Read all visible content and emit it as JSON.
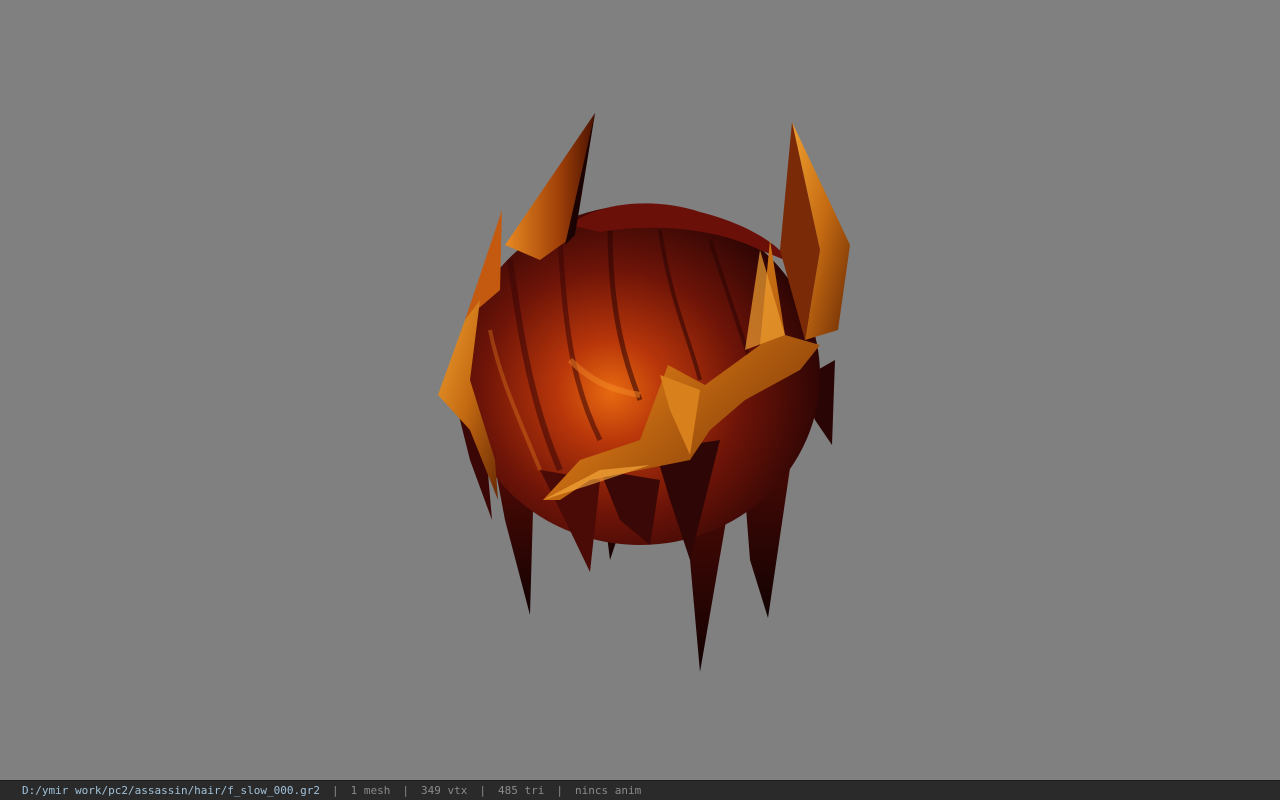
{
  "viewport": {
    "background": "#808080",
    "model": "hair mesh (orange-red spiky hair with golden horn-like spikes)"
  },
  "status_bar": {
    "file_path": "D:/ymir work/pc2/assassin/hair/f_slow_000.gr2",
    "separator": "|",
    "mesh_count": "1 mesh",
    "vertex_count": "349 vtx",
    "triangle_count": "485 tri",
    "anim_status": "nincs anim",
    "path_color": "#9fc0d8",
    "text_color": "#8a8a8a"
  }
}
